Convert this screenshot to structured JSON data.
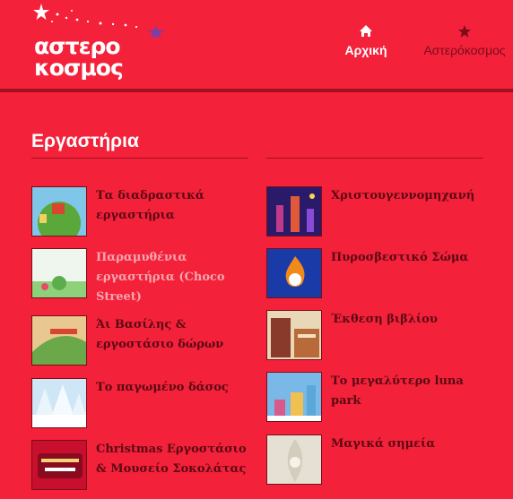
{
  "header": {
    "logo_line1": "αστερο",
    "logo_line2": "κοσμος",
    "nav": [
      {
        "label": "Αρχική",
        "icon": "home-icon"
      },
      {
        "label": "Αστερόκοσμος",
        "icon": "star-icon"
      }
    ]
  },
  "main": {
    "title": "Εργαστήρια",
    "left_items": [
      {
        "label": "Τα διαδραστικά εργαστήρια",
        "dim": false
      },
      {
        "label": "Παραμυθένια εργαστήρια (Choco Street)",
        "dim": true
      },
      {
        "label": "Άι Βασίλης & εργοστάσιο δώρων",
        "dim": false
      },
      {
        "label": "Το παγωμένο δάσος",
        "dim": false
      },
      {
        "label": "Christmas Εργοστάσιο & Μουσείο Σοκολάτας",
        "dim": false
      }
    ],
    "right_items": [
      {
        "label": "Χριστουγεννομηχανή"
      },
      {
        "label": "Πυροσβεστικό Σώμα"
      },
      {
        "label": "Έκθεση βιβλίου"
      },
      {
        "label": "Το μεγαλύτερο luna park"
      },
      {
        "label": "Μαγικά σημεία"
      }
    ]
  },
  "colors": {
    "background": "#f4213a",
    "header_rule": "#a30f1f",
    "link_text": "#5a0a12"
  }
}
